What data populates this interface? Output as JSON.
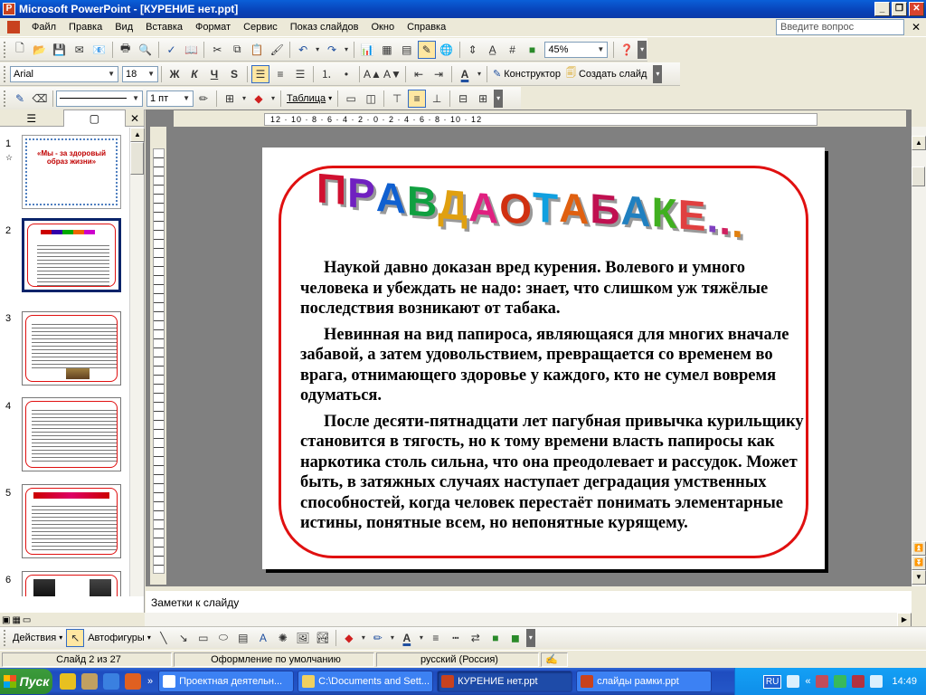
{
  "window": {
    "title": "Microsoft PowerPoint - [КУРЕНИЕ нет.ppt]"
  },
  "menu": {
    "items": [
      "Файл",
      "Правка",
      "Вид",
      "Вставка",
      "Формат",
      "Сервис",
      "Показ слайдов",
      "Окно",
      "Справка"
    ],
    "help_placeholder": "Введите вопрос"
  },
  "toolbar_standard": {
    "zoom": "45%"
  },
  "toolbar_format": {
    "font": "Arial",
    "size": "18",
    "bold": "Ж",
    "italic": "К",
    "underline": "Ч",
    "shadow": "S",
    "designer": "Конструктор",
    "new_slide": "Создать слайд"
  },
  "toolbar_tables": {
    "line_width": "1 пт",
    "table": "Таблица"
  },
  "slides_pane": {
    "numbers": [
      "1",
      "2",
      "3",
      "4",
      "5",
      "6"
    ],
    "selected": 2,
    "thumb1_title": "«Мы - за здоровый образ жизни»"
  },
  "ruler": {
    "h": "12 · 10 · 8 · 6 · 4 · 2 · 0 · 2 · 4 · 6 · 8 · 10 · 12"
  },
  "slide": {
    "title": "ПРАВДА О ТАБАКЕ...",
    "paragraphs": [
      "Наукой давно доказан вред курения. Волевого и умного человека и убеждать не надо: знает, что слишком уж тяжёлые последствия возникают от табака.",
      "Невинная на вид папироса, являющаяся для многих вначале забавой, а затем удовольствием, превращается со временем во врага, отнимающего здоровье у каждого, кто не сумел вовремя одуматься.",
      "После десяти-пятнадцати лет пагубная привычка курильщику становится в тягость, но к тому времени власть папиросы как наркотика столь сильна, что она преодолевает и рассудок. Может быть, в затяжных случаях наступает деградация умственных способностей, когда человек перестаёт понимать элементарные истины, понятные  всем, но непонятные курящему."
    ]
  },
  "notes": {
    "placeholder": "Заметки к слайду"
  },
  "drawing_toolbar": {
    "actions": "Действия",
    "autoshapes": "Автофигуры"
  },
  "status": {
    "slide": "Слайд 2 из 27",
    "design": "Оформление по умолчанию",
    "language": "русский (Россия)"
  },
  "taskbar": {
    "start": "Пуск",
    "tasks": [
      "Проектная деятельн...",
      "C:\\Documents and Sett...",
      "КУРЕНИЕ нет.ppt",
      "слайды рамки.ppt"
    ],
    "lang": "RU",
    "clock": "14:49"
  },
  "colors": {
    "title_bar": "#0842b8",
    "slide_border": "#e01010",
    "taskbar": "#2456c7"
  }
}
